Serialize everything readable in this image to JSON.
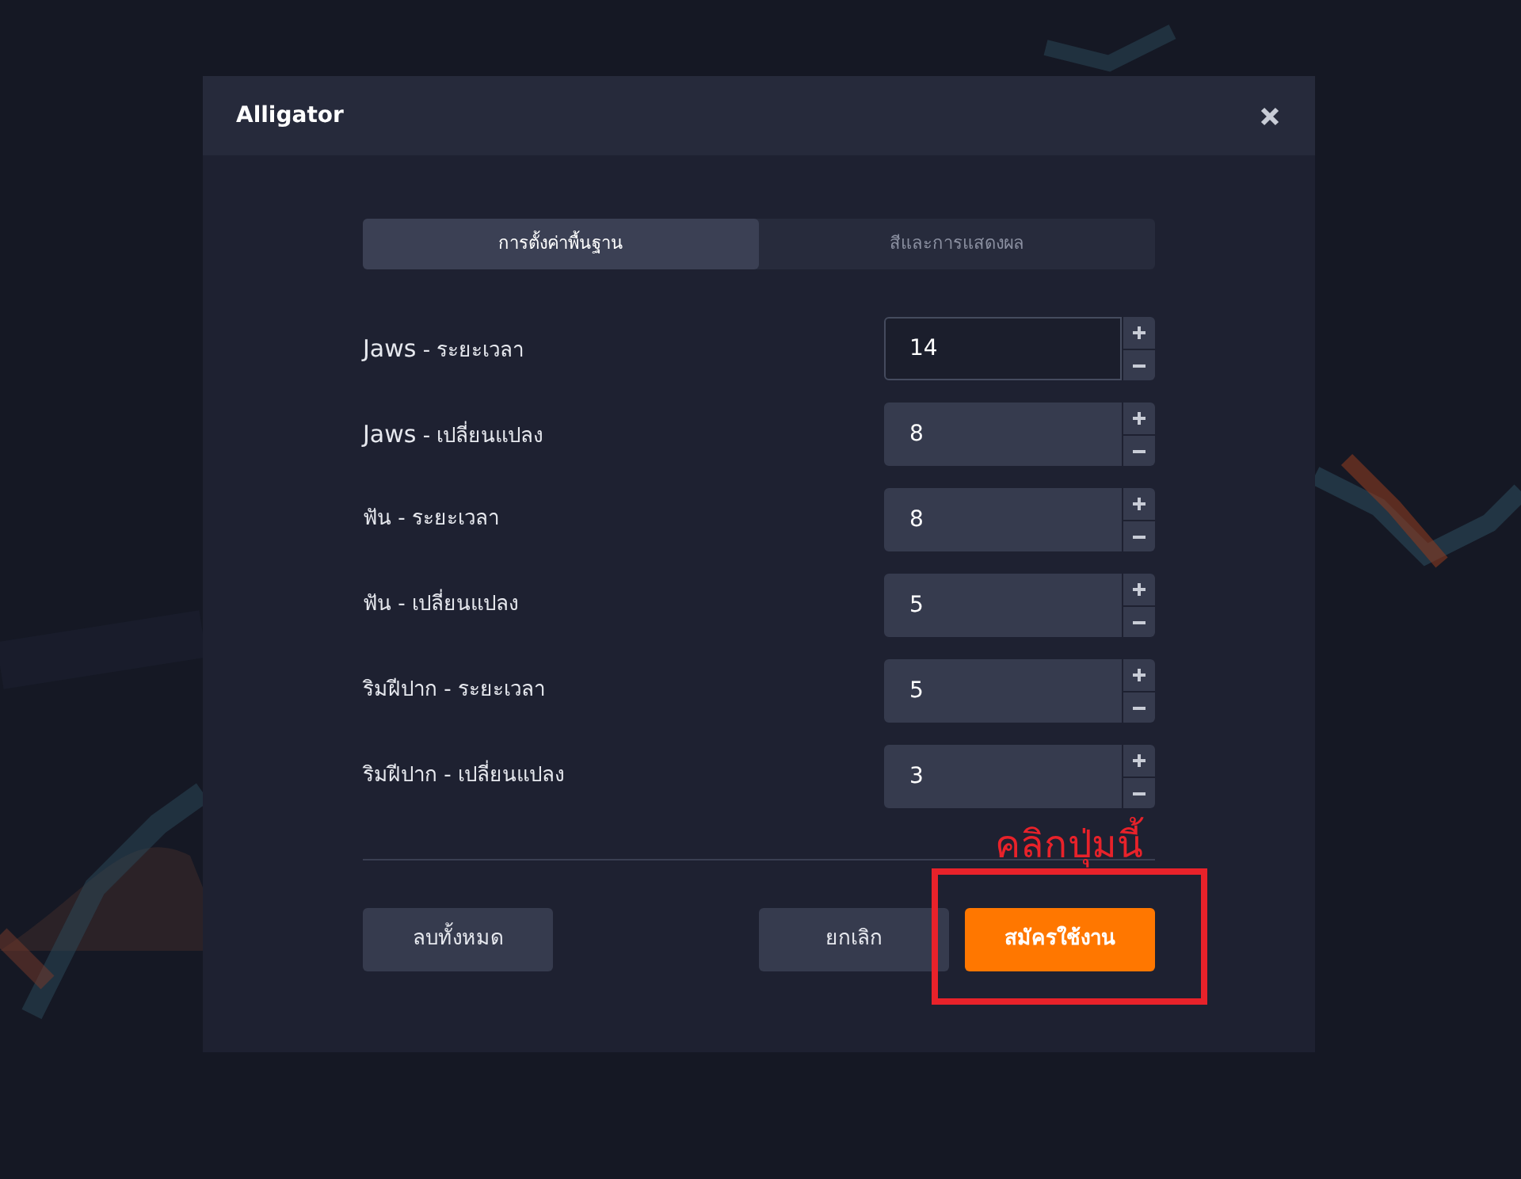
{
  "dialog": {
    "title": "Alligator"
  },
  "tabs": [
    {
      "label": "การตั้งค่าพื้นฐาน",
      "selected": true
    },
    {
      "label": "สีและการแสดงผล",
      "selected": false
    }
  ],
  "fields": [
    {
      "label_main": "Jaws",
      "label_rest": " - ระยะเวลา",
      "value": "14",
      "focused": true
    },
    {
      "label_main": "Jaws",
      "label_rest": " - เปลี่ยนแปลง",
      "value": "8",
      "focused": false
    },
    {
      "label_main": "ฟัน",
      "label_rest": " - ระยะเวลา",
      "value": "8",
      "focused": false
    },
    {
      "label_main": "ฟัน",
      "label_rest": " - เปลี่ยนแปลง",
      "value": "5",
      "focused": false
    },
    {
      "label_main": "ริมฝีปาก",
      "label_rest": " - ระยะเวลา",
      "value": "5",
      "focused": false
    },
    {
      "label_main": "ริมฝีปาก",
      "label_rest": " - เปลี่ยนแปลง",
      "value": "3",
      "focused": false
    }
  ],
  "buttons": [
    {
      "label": "ลบทั้งหมด",
      "kind": "secondary"
    },
    {
      "label": "ยกเลิก",
      "kind": "secondary"
    },
    {
      "label": "สมัครใช้งาน",
      "kind": "primary"
    }
  ],
  "annotation": {
    "text": "คลิกปุ่มนี้"
  }
}
